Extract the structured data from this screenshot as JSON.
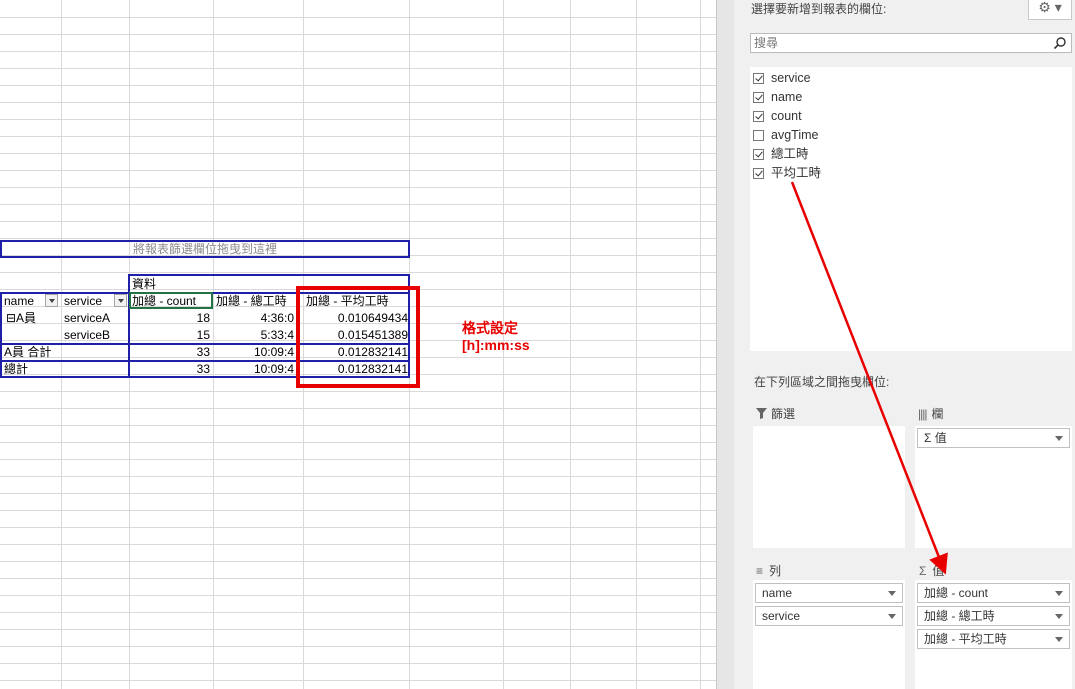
{
  "pivot": {
    "filter_drop_hint": "將報表篩選欄位拖曳到這裡",
    "data_header": "資料",
    "col_name": "name",
    "col_service": "service",
    "col_count": "加總 - count",
    "col_total_hours": "加總 - 總工時",
    "col_avg_hours": "加總 - 平均工時",
    "rows": [
      {
        "name": "⊟A員",
        "service": "serviceA",
        "count": "18",
        "total": "4:36:0",
        "avg": "0.010649434"
      },
      {
        "name": "",
        "service": "serviceB",
        "count": "15",
        "total": "5:33:4",
        "avg": "0.015451389"
      },
      {
        "name": "A員 合計",
        "service": "",
        "count": "33",
        "total": "10:09:4",
        "avg": "0.012832141"
      },
      {
        "name": "總計",
        "service": "",
        "count": "33",
        "total": "10:09:4",
        "avg": "0.012832141"
      }
    ]
  },
  "annotation": {
    "line1": "格式設定",
    "line2": "[h]:mm:ss",
    "color": "#e80000"
  },
  "field_pane": {
    "title": "選擇要新增到報表的欄位:",
    "search_placeholder": "搜尋",
    "fields": [
      {
        "label": "service",
        "checked": true
      },
      {
        "label": "name",
        "checked": true
      },
      {
        "label": "count",
        "checked": true
      },
      {
        "label": "avgTime",
        "checked": false
      },
      {
        "label": "總工時",
        "checked": true
      },
      {
        "label": "平均工時",
        "checked": true
      }
    ],
    "drag_hint": "在下列區域之間拖曳欄位:",
    "filters_label": "篩選",
    "columns_label": "欄",
    "rows_label": "列",
    "values_label": "值",
    "columns_items": [
      "Σ 值"
    ],
    "rows_items": [
      "name",
      "service"
    ],
    "values_items": [
      "加總 - count",
      "加總 - 總工時",
      "加總 - 平均工時"
    ]
  }
}
